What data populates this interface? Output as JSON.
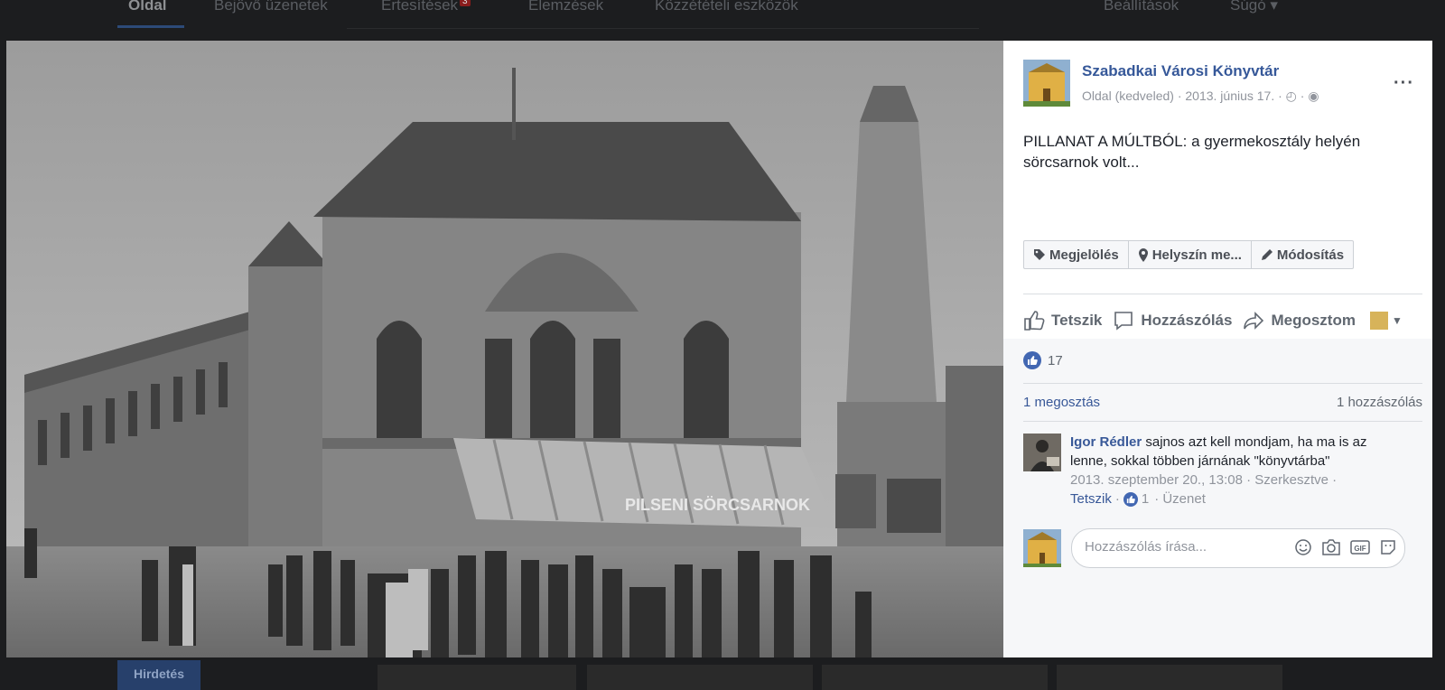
{
  "background_nav": {
    "items": [
      "Oldal",
      "Bejövő üzenetek",
      "Értesítések",
      "Elemzések",
      "Közzétételi eszközök"
    ],
    "notifications_badge": "3",
    "settings": "Beállítások",
    "help": "Súgó ▾",
    "ad_button": "Hirdetés"
  },
  "post": {
    "page_name": "Szabadkai Városi Könyvtár",
    "page_meta": "Oldal (kedveled) · 2013. június 17. · ◴ · ◉",
    "more": "···",
    "text": "PILLANAT A MÚLTBÓL: a gyermekosztály helyén sörcsarnok volt...",
    "photo_sign": "PILSENI SÖRCSARNOK"
  },
  "tagbar": {
    "tag": "Megjelölés",
    "location": "Helyszín me...",
    "edit": "Módosítás"
  },
  "actions": {
    "like": "Tetszik",
    "comment": "Hozzászólás",
    "share": "Megosztom"
  },
  "feedback": {
    "like_count": "17",
    "shares": "1 megosztás",
    "comments": "1 hozzászólás"
  },
  "comment": {
    "author": "Igor Rédler",
    "text": " sajnos azt kell mondjam, ha ma is az lenne, sokkal többen járnának \"könyvtárba\"",
    "meta": "2013. szeptember 20., 13:08 · Szerkesztve ·",
    "like_link": "Tetszik",
    "separator": "·",
    "likes": "1",
    "reply": "· Üzenet"
  },
  "reply": {
    "placeholder": "Hozzászólás írása..."
  },
  "colors": {
    "link": "#365899",
    "like_blue": "#4267b2",
    "panel_bg": "#ffffff",
    "feedback_bg": "#f6f7f9"
  }
}
